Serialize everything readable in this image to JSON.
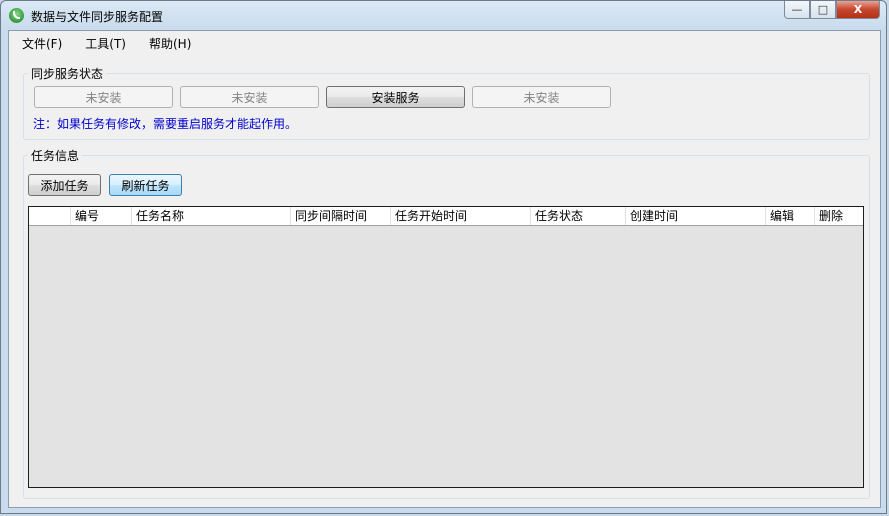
{
  "window": {
    "title": "数据与文件同步服务配置",
    "minimize": "—",
    "maximize": "□",
    "close": "X"
  },
  "menu": [
    "文件(F)",
    "工具(T)",
    "帮助(H)"
  ],
  "service_group": {
    "title": "同步服务状态",
    "buttons": [
      {
        "label": "未安装",
        "enabled": false
      },
      {
        "label": "未安装",
        "enabled": false
      },
      {
        "label": "安装服务",
        "enabled": true
      },
      {
        "label": "未安装",
        "enabled": false
      }
    ],
    "note": "注：如果任务有修改，需要重启服务才能起作用。"
  },
  "task_group": {
    "title": "任务信息",
    "add_button": "添加任务",
    "refresh_button": "刷新任务",
    "columns": [
      "",
      "编号",
      "任务名称",
      "同步间隔时间",
      "任务开始时间",
      "任务状态",
      "创建时间",
      "编辑",
      "删除"
    ],
    "rows": []
  }
}
